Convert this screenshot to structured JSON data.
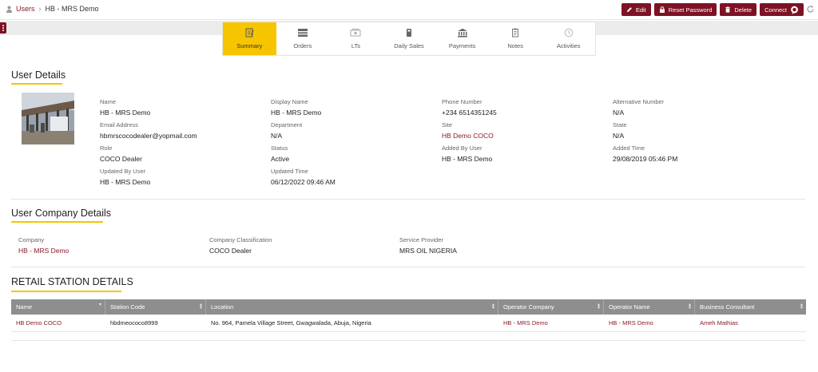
{
  "breadcrumb": {
    "parent": "Users",
    "current": "HB - MRS Demo"
  },
  "actions": {
    "edit": "Edit",
    "reset_password": "Reset Password",
    "delete": "Delete",
    "connect": "Connect"
  },
  "tabs": [
    {
      "label": "Summary",
      "icon": "summary-icon",
      "active": true
    },
    {
      "label": "Orders",
      "icon": "orders-icon"
    },
    {
      "label": "LTs",
      "icon": "lts-icon"
    },
    {
      "label": "Daily Sales",
      "icon": "daily-sales-icon"
    },
    {
      "label": "Payments",
      "icon": "bank-icon"
    },
    {
      "label": "Notes",
      "icon": "notes-icon"
    },
    {
      "label": "Activities",
      "icon": "activities-icon"
    }
  ],
  "user_details": {
    "title": "User Details",
    "name_label": "Name",
    "name": "HB - MRS Demo",
    "display_name_label": "Display Name",
    "display_name": "HB - MRS Demo",
    "phone_label": "Phone Number",
    "phone": "+234 6514351245",
    "alt_label": "Alternative Number",
    "alt": "N/A",
    "email_label": "Email Address",
    "email": "hbmrscocodealer@yopmail.com",
    "department_label": "Department",
    "department": "N/A",
    "site_label": "Site",
    "site": "HB Demo COCO",
    "state_label": "State",
    "state": "N/A",
    "role_label": "Role",
    "role": "COCO Dealer",
    "status_label": "Status",
    "status": "Active",
    "added_by_label": "Added By User",
    "added_by": "HB - MRS Demo",
    "added_time_label": "Added Time",
    "added_time": "29/08/2019 05:46 PM",
    "updated_by_label": "Updated By User",
    "updated_by": "HB - MRS Demo",
    "updated_time_label": "Updated Time",
    "updated_time": "06/12/2022 09:46 AM"
  },
  "company_details": {
    "title": "User Company Details",
    "company_label": "Company",
    "company": "HB - MRS Demo",
    "classification_label": "Company Classification",
    "classification": "COCO Dealer",
    "provider_label": "Service Provider",
    "provider": "MRS OIL NIGERIA"
  },
  "retail": {
    "title": "RETAIL STATION DETAILS",
    "columns": [
      "Name",
      "Station Code",
      "Location",
      "Operator Company",
      "Operator Name",
      "Business Consultant"
    ],
    "rows": [
      [
        "HB Demo COCO",
        "hbdmeococo8999",
        "No. 964, Pamela Village Street, Gwagwalada, Abuja, Nigeria",
        "HB - MRS Demo",
        "HB - MRS Demo",
        "Ameh Mathias"
      ]
    ]
  },
  "colors": {
    "brand": "#7d1224",
    "accent": "#f6c500",
    "link": "#8b1a2b"
  }
}
